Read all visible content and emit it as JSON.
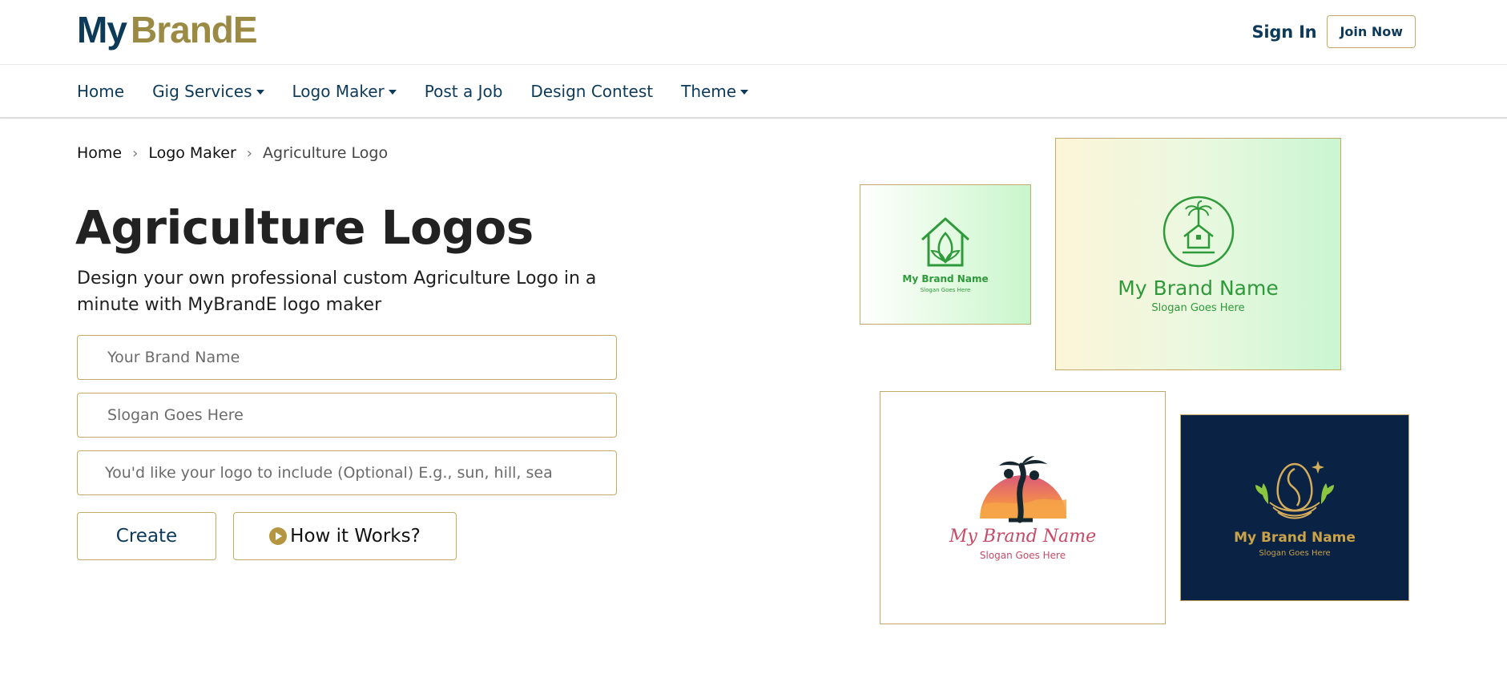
{
  "header": {
    "logo_text_primary": "My",
    "logo_text_secondary": "BrandE",
    "sign_in_label": "Sign In",
    "join_now_label": "Join Now"
  },
  "nav": {
    "items": [
      {
        "label": "Home",
        "has_dropdown": false
      },
      {
        "label": "Gig Services",
        "has_dropdown": true
      },
      {
        "label": "Logo Maker",
        "has_dropdown": true
      },
      {
        "label": "Post a Job",
        "has_dropdown": false
      },
      {
        "label": "Design Contest",
        "has_dropdown": false
      },
      {
        "label": "Theme",
        "has_dropdown": true
      }
    ]
  },
  "breadcrumb": {
    "items": [
      "Home",
      "Logo Maker",
      "Agriculture Logo"
    ]
  },
  "main": {
    "title": "Agriculture Logos",
    "subtitle": "Design your own professional custom Agriculture Logo in a minute with MyBrandE logo maker",
    "brand_placeholder": "Your Brand Name",
    "slogan_placeholder": "Slogan Goes Here",
    "include_placeholder": "You'd like your logo to include (Optional) E.g., sun, hill, sea",
    "create_label": "Create",
    "how_label": "How it Works?"
  },
  "previews": [
    {
      "name": "My Brand Name",
      "slogan": "Slogan Goes Here",
      "icon": "house-leaf-icon"
    },
    {
      "name": "My Brand Name",
      "slogan": "Slogan Goes Here",
      "icon": "palm-house-circle-icon"
    },
    {
      "name": "My Brand Name",
      "slogan": "Slogan Goes Here",
      "icon": "sunset-tree-icon"
    },
    {
      "name": "My Brand Name",
      "slogan": "Slogan Goes Here",
      "icon": "golden-egg-nest-icon"
    }
  ],
  "colors": {
    "brand_navy": "#0e3a5a",
    "brand_gold": "#9b8a44",
    "border_gold": "#c5a968",
    "green": "#2e9a3a",
    "pink": "#c74a66",
    "dark_navy": "#0a2244"
  }
}
